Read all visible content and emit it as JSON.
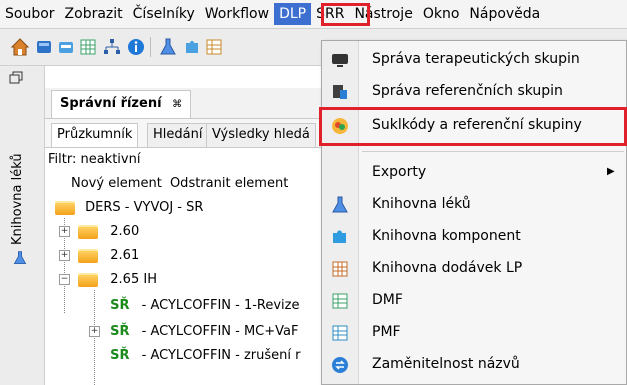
{
  "menubar": {
    "items": [
      "Soubor",
      "Zobrazit",
      "Číselníky",
      "Workflow",
      "DLP",
      "SRR",
      "Nástroje",
      "Okno",
      "Nápověda"
    ],
    "active_index": 4
  },
  "sidebar": {
    "label": "Knihovna léků"
  },
  "panel": {
    "title": "Správní řízení",
    "close_glyph": "⌘",
    "tabs": [
      "Průzkumník",
      "Hledání",
      "Výsledky hledá"
    ],
    "filter_label": "Filtr: neaktivní",
    "actions": [
      "Nový element",
      "Odstranit element"
    ],
    "tree": {
      "root": "DERS - VYVOJ - SR",
      "nodes": [
        {
          "toggle": "+",
          "label": "2.60"
        },
        {
          "toggle": "+",
          "label": "2.61"
        },
        {
          "toggle": "−",
          "label": "2.65 IH"
        }
      ],
      "children": [
        {
          "badge": "SŘ",
          "label": "- ACYLCOFFIN - 1-Revize",
          "toggle": ""
        },
        {
          "badge": "SŘ",
          "label": "- ACYLCOFFIN - MC+VaF",
          "toggle": "+"
        },
        {
          "badge": "SŘ",
          "label": "- ACYLCOFFIN - zrušení r",
          "toggle": ""
        }
      ]
    }
  },
  "dropdown": {
    "items_top": [
      {
        "label": "Správa terapeutických skupin",
        "icon": "monitor-icon"
      },
      {
        "label": "Správa referenčních skupin",
        "icon": "server-icon"
      },
      {
        "label": "Suklkódy a referenční skupiny",
        "icon": "colors-icon"
      }
    ],
    "items_bottom": [
      {
        "label": "Exporty",
        "icon": "",
        "submenu": "▶"
      },
      {
        "label": "Knihovna léků",
        "icon": "flask-icon"
      },
      {
        "label": "Knihovna komponent",
        "icon": "puzzle-icon"
      },
      {
        "label": "Knihovna dodávek LP",
        "icon": "grid-icon"
      },
      {
        "label": "DMF",
        "icon": "table-icon"
      },
      {
        "label": "PMF",
        "icon": "table-icon"
      },
      {
        "label": "Zaměnitelnost názvů",
        "icon": "swap-icon"
      }
    ]
  },
  "colors": {
    "highlight_red": "#e0212b",
    "menu_active": "#3d6fd1",
    "sr_green": "#1b8a1b"
  }
}
